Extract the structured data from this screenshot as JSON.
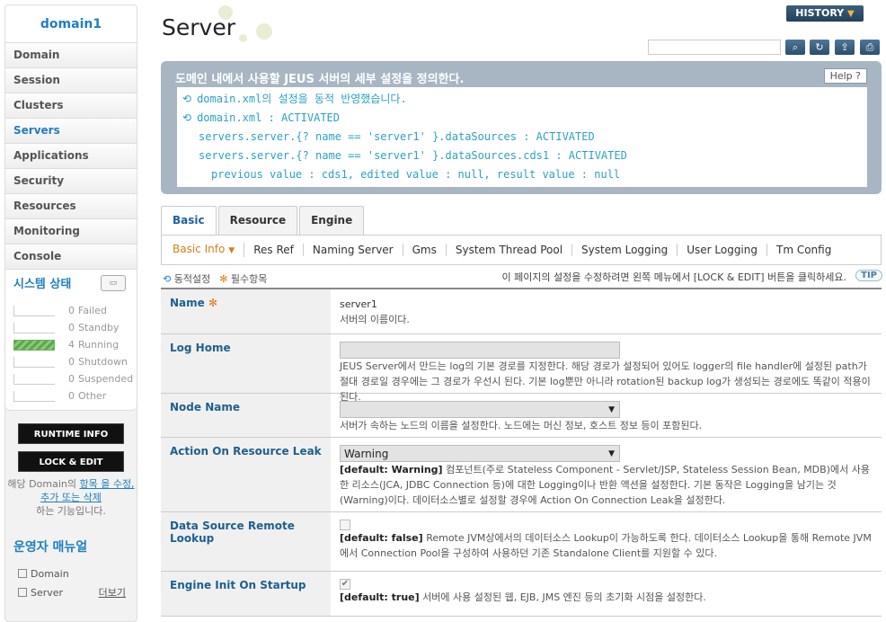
{
  "sidebar": {
    "domain": "domain1",
    "nav": [
      "Domain",
      "Session",
      "Clusters",
      "Servers",
      "Applications",
      "Security",
      "Resources",
      "Monitoring",
      "Console"
    ],
    "active": "Servers",
    "status_title": "시스템 상태",
    "status": [
      {
        "count": "0",
        "label": "Failed",
        "fill": 0
      },
      {
        "count": "0",
        "label": "Standby",
        "fill": 0
      },
      {
        "count": "4",
        "label": "Running",
        "fill": 1
      },
      {
        "count": "0",
        "label": "Shutdown",
        "fill": 0
      },
      {
        "count": "0",
        "label": "Suspended",
        "fill": 0
      },
      {
        "count": "0",
        "label": "Other",
        "fill": 0
      }
    ],
    "runtime_btn": "RUNTIME INFO",
    "lock_btn": "LOCK & EDIT",
    "note_pre": "해당 Domain의",
    "note_link": "항목 을 수정, 추가 또는 삭제",
    "note_post": "하는 기능입니다.",
    "manual_title": "운영자 매뉴얼",
    "manual_items": [
      "Domain",
      "Server"
    ],
    "more": "더보기"
  },
  "header": {
    "title": "Server",
    "history": "HISTORY"
  },
  "info": {
    "title": "도메인 내에서 사용할 JEUS 서버의 세부 설정을 정의한다.",
    "help": "Help",
    "messages": [
      "domain.xml의 설정을 동적 반영했습니다.",
      "domain.xml : ACTIVATED",
      "servers.server.{? name == 'server1' }.dataSources : ACTIVATED",
      "servers.server.{? name == 'server1' }.dataSources.cds1 : ACTIVATED",
      "previous value : cds1, edited value : null, result value : null"
    ]
  },
  "tabs": [
    "Basic",
    "Resource",
    "Engine"
  ],
  "subtabs": [
    "Basic Info",
    "Res Ref",
    "Naming Server",
    "Gms",
    "System Thread Pool",
    "System Logging",
    "User Logging",
    "Tm Config"
  ],
  "legend": {
    "dynamic": "동적설정",
    "required": "필수항목"
  },
  "tip_text": "이 페이지의 설정을 수정하려면 왼쪽 메뉴에서 [LOCK & EDIT] 버튼을 클릭하세요.",
  "tip": "TIP",
  "fields": {
    "name": {
      "label": "Name",
      "value": "server1",
      "desc": "서버의 이름이다."
    },
    "log_home": {
      "label": "Log Home",
      "desc": "JEUS Server에서 만드는 log의 기본 경로를 지정한다. 해당 경로가 설정되어 있어도 logger의 file handler에 설정된 path가 절대 경로일 경우에는 그 경로가 우선시 된다. 기본 log뿐만 아니라 rotation된 backup log가 생성되는 경로에도 똑같이 적용이 된다."
    },
    "node_name": {
      "label": "Node Name",
      "desc": "서버가 속하는 노드의 이름을 설정한다. 노드에는 머신 정보, 호스트 정보 등이 포함된다."
    },
    "leak": {
      "label": "Action On Resource Leak",
      "value": "Warning",
      "default": "[default: Warning]",
      "desc": "컴포넌트(주로 Stateless Component - Servlet/JSP, Stateless Session Bean, MDB)에서 사용한 리소스(JCA, JDBC Connection 등)에 대한 Logging이나 반환 액션을 설정한다. 기본 동작은 Logging을 남기는 것(Warning)이다. 데이터소스별로 설정할 경우에 Action On Connection Leak을 설정한다."
    },
    "remote": {
      "label": "Data Source Remote Lookup",
      "default": "[default: false]",
      "desc": "Remote JVM상에서의 데이터소스 Lookup이 가능하도록 한다. 데이터소스 Lookup을 통해 Remote JVM에서 Connection Pool을 구성하여 사용하던 기존 Standalone Client를 지원할 수 있다."
    },
    "engine": {
      "label": "Engine Init On Startup",
      "default": "[default: true]",
      "desc": "서버에 사용 설정된 웹, EJB, JMS 엔진 등의 초기화 시점을 설정한다."
    }
  }
}
